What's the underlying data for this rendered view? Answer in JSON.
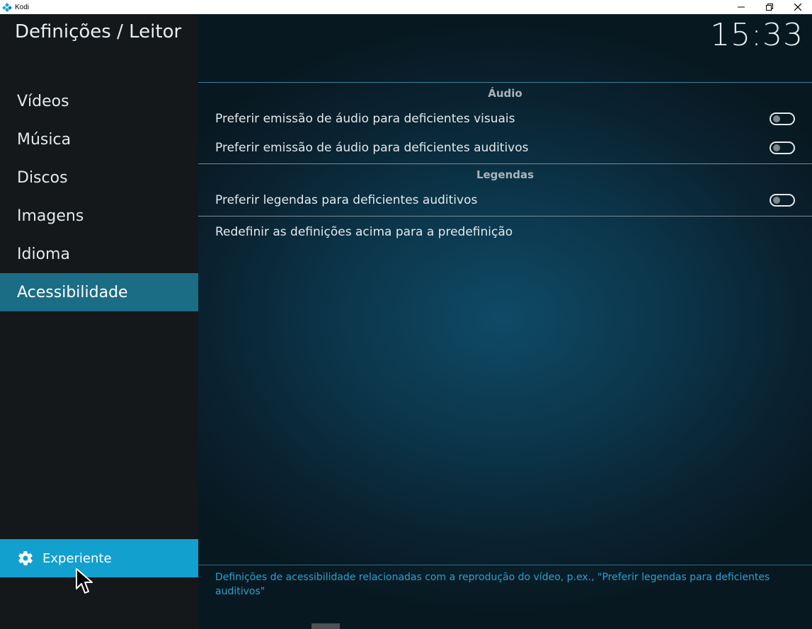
{
  "window": {
    "title": "Kodi"
  },
  "header": {
    "page_title": "Definições / Leitor",
    "clock": "15:33"
  },
  "sidebar": {
    "items": [
      {
        "label": "Vídeos",
        "active": false
      },
      {
        "label": "Música",
        "active": false
      },
      {
        "label": "Discos",
        "active": false
      },
      {
        "label": "Imagens",
        "active": false
      },
      {
        "label": "Idioma",
        "active": false
      },
      {
        "label": "Acessibilidade",
        "active": true
      }
    ],
    "level_button": {
      "label": "Experiente",
      "icon": "gear-icon"
    }
  },
  "settings": {
    "groups": [
      {
        "header": "Áudio",
        "items": [
          {
            "label": "Preferir emissão de áudio para deficientes visuais",
            "enabled": false
          },
          {
            "label": "Preferir emissão de áudio para deficientes auditivos",
            "enabled": false
          }
        ]
      },
      {
        "header": "Legendas",
        "items": [
          {
            "label": "Preferir legendas para deficientes auditivos",
            "enabled": false
          }
        ]
      }
    ],
    "reset_label": "Redefinir as definições acima para a predefinição"
  },
  "description": "Definições de acessibilidade relacionadas com a reprodução do vídeo, p.ex., \"Preferir legendas para deficientes auditivos\"",
  "colors": {
    "accent": "#12a0cf",
    "active_item": "#1b6d86",
    "description_text": "#2aa3cf"
  }
}
